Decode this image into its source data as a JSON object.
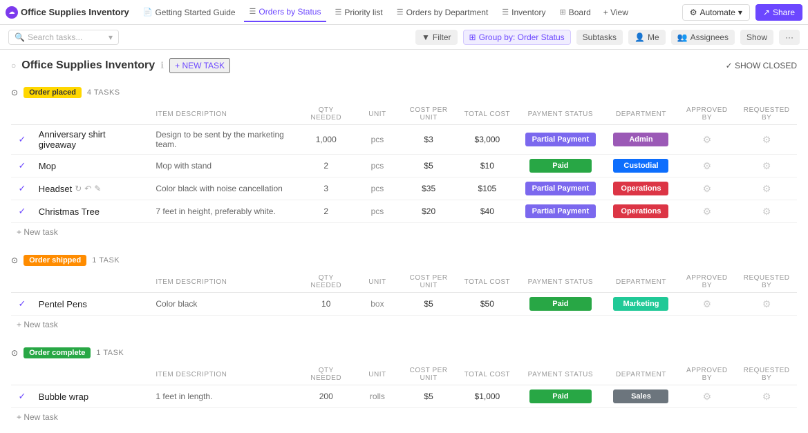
{
  "app": {
    "icon": "☁",
    "title": "Office Supplies Inventory"
  },
  "tabs": [
    {
      "id": "getting-started",
      "label": "Getting Started Guide",
      "icon": "📄",
      "active": false
    },
    {
      "id": "orders-by-status",
      "label": "Orders by Status",
      "icon": "☰",
      "active": true
    },
    {
      "id": "priority-list",
      "label": "Priority list",
      "icon": "☰",
      "active": false
    },
    {
      "id": "orders-by-dept",
      "label": "Orders by Department",
      "icon": "☰",
      "active": false
    },
    {
      "id": "inventory",
      "label": "Inventory",
      "icon": "☰",
      "active": false
    },
    {
      "id": "board",
      "label": "Board",
      "icon": "⊞",
      "active": false
    }
  ],
  "nav_right": {
    "add_view": "+ View",
    "automate": "Automate",
    "share": "Share"
  },
  "toolbar": {
    "search_placeholder": "Search tasks...",
    "filter": "Filter",
    "group_by": "Group by: Order Status",
    "subtasks": "Subtasks",
    "me": "Me",
    "assignees": "Assignees",
    "show": "Show"
  },
  "page": {
    "title": "Office Supplies Inventory",
    "new_task": "+ NEW TASK",
    "show_closed": "✓ SHOW CLOSED"
  },
  "groups": [
    {
      "id": "order-placed",
      "status": "Order placed",
      "badge_class": "badge-order-placed",
      "task_count": "4 TASKS",
      "expanded": true,
      "columns": [
        "ITEM DESCRIPTION",
        "QTY NEEDED",
        "UNIT",
        "COST PER UNIT",
        "TOTAL COST",
        "PAYMENT STATUS",
        "DEPARTMENT",
        "APPROVED BY",
        "REQUESTED BY"
      ],
      "tasks": [
        {
          "id": "t1",
          "name": "Anniversary shirt giveaway",
          "checked": true,
          "description": "Design to be sent by the marketing team.",
          "qty": "1,000",
          "unit": "pcs",
          "cost_per_unit": "$3",
          "total_cost": "$3,000",
          "payment_status": "Partial Payment",
          "payment_class": "partial-badge",
          "department": "Admin",
          "dept_class": "dept-admin"
        },
        {
          "id": "t2",
          "name": "Mop",
          "checked": true,
          "description": "Mop with stand",
          "qty": "2",
          "unit": "pcs",
          "cost_per_unit": "$5",
          "total_cost": "$10",
          "payment_status": "Paid",
          "payment_class": "paid-badge",
          "department": "Custodial",
          "dept_class": "dept-custodial"
        },
        {
          "id": "t3",
          "name": "Headset",
          "checked": true,
          "description": "Color black with noise cancellation",
          "qty": "3",
          "unit": "pcs",
          "cost_per_unit": "$35",
          "total_cost": "$105",
          "payment_status": "Partial Payment",
          "payment_class": "partial-badge",
          "department": "Operations",
          "dept_class": "dept-operations",
          "has_actions": true
        },
        {
          "id": "t4",
          "name": "Christmas Tree",
          "checked": true,
          "description": "7 feet in height, preferably white.",
          "qty": "2",
          "unit": "pcs",
          "cost_per_unit": "$20",
          "total_cost": "$40",
          "payment_status": "Partial Payment",
          "payment_class": "partial-badge",
          "department": "Operations",
          "dept_class": "dept-operations"
        }
      ]
    },
    {
      "id": "order-shipped",
      "status": "Order shipped",
      "badge_class": "badge-order-shipped",
      "task_count": "1 TASK",
      "expanded": true,
      "columns": [
        "ITEM DESCRIPTION",
        "QTY NEEDED",
        "UNIT",
        "COST PER UNIT",
        "TOTAL COST",
        "PAYMENT STATUS",
        "DEPARTMENT",
        "APPROVED BY",
        "REQUESTED BY"
      ],
      "tasks": [
        {
          "id": "t5",
          "name": "Pentel Pens",
          "checked": true,
          "description": "Color black",
          "qty": "10",
          "unit": "box",
          "cost_per_unit": "$5",
          "total_cost": "$50",
          "payment_status": "Paid",
          "payment_class": "paid-badge",
          "department": "Marketing",
          "dept_class": "dept-marketing"
        }
      ]
    },
    {
      "id": "order-complete",
      "status": "Order complete",
      "badge_class": "badge-order-complete",
      "task_count": "1 TASK",
      "expanded": true,
      "columns": [
        "ITEM DESCRIPTION",
        "QTY NEEDED",
        "UNIT",
        "COST PER UNIT",
        "TOTAL COST",
        "PAYMENT STATUS",
        "DEPARTMENT",
        "APPROVED BY",
        "REQUESTED BY"
      ],
      "tasks": [
        {
          "id": "t6",
          "name": "Bubble wrap",
          "checked": true,
          "description": "1 feet in length.",
          "qty": "200",
          "unit": "rolls",
          "cost_per_unit": "$5",
          "total_cost": "$1,000",
          "payment_status": "Paid",
          "payment_class": "paid-badge",
          "department": "Sales",
          "dept_class": "dept-sales"
        }
      ]
    }
  ],
  "new_task_label": "+ New task"
}
